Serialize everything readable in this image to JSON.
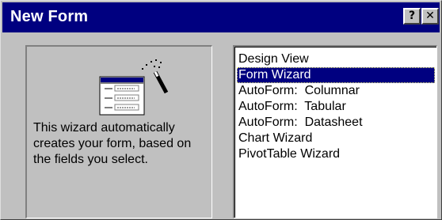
{
  "window": {
    "title": "New Form",
    "help_button_label": "?",
    "close_button_label": "✕",
    "title_bar_color": "#000080",
    "face_color": "#c0c0c0"
  },
  "preview": {
    "illustration_icon": "form-wizard-magic-wand-icon",
    "description": "This wizard automatically creates your form, based on the fields you select."
  },
  "form_types": {
    "selected_index": 1,
    "selection_color": "#000080",
    "items": [
      {
        "label": "Design View"
      },
      {
        "label": "Form Wizard"
      },
      {
        "label": "AutoForm:  Columnar"
      },
      {
        "label": "AutoForm:  Tabular"
      },
      {
        "label": "AutoForm:  Datasheet"
      },
      {
        "label": "Chart Wizard"
      },
      {
        "label": "PivotTable Wizard"
      }
    ]
  }
}
